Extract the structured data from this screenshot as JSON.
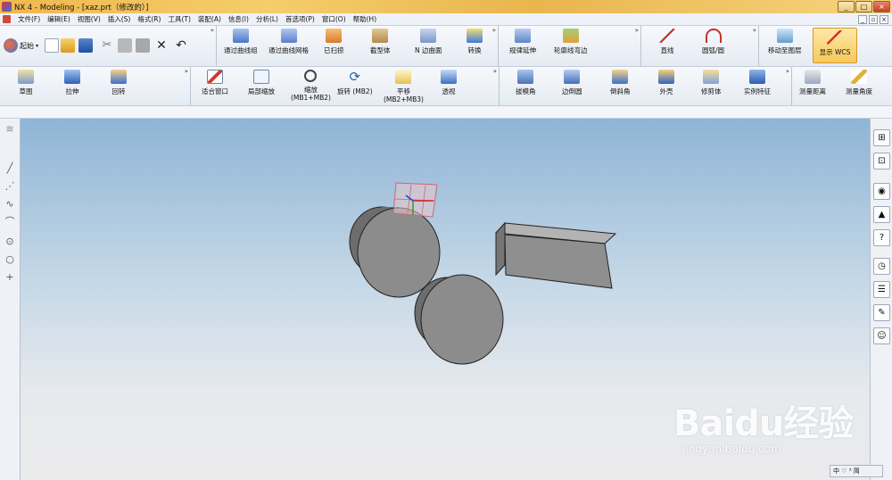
{
  "window": {
    "title": "NX 4 - Modeling - [xaz.prt（修改的）]",
    "buttons": {
      "minimize": "_",
      "maximize": "□",
      "close": "×"
    }
  },
  "menu": {
    "items": [
      "文件(F)",
      "编辑(E)",
      "视图(V)",
      "插入(S)",
      "格式(R)",
      "工具(T)",
      "装配(A)",
      "信息(I)",
      "分析(L)",
      "首选项(P)",
      "窗口(O)",
      "帮助(H)"
    ],
    "mdi_buttons": {
      "minimize": "_",
      "restore": "▫",
      "close": "×"
    }
  },
  "toolbar_top": {
    "start_label": "起始",
    "curve_tools": [
      "通过曲线组",
      "通过曲线网格",
      "已扫掠",
      "截型体",
      "N 边曲面",
      "转换"
    ],
    "rule_tools": [
      "规律延伸",
      "轮廓线弯边"
    ],
    "sketch_tools": [
      "直线",
      "圆弧/圆"
    ],
    "layer_tools": [
      "移动至图层",
      "显示 WCS"
    ]
  },
  "toolbar_bottom": {
    "feature_tools": [
      "草图",
      "拉伸",
      "回转"
    ],
    "view_tools": [
      {
        "label": "适合窗口",
        "sub": ""
      },
      {
        "label": "局部缩放",
        "sub": ""
      },
      {
        "label": "缩放",
        "sub": "(MB1+MB2)"
      },
      {
        "label": "旋转 (MB2)",
        "sub": ""
      },
      {
        "label": "平移",
        "sub": "(MB2+MB3)"
      },
      {
        "label": "透视",
        "sub": ""
      }
    ],
    "detail_tools": [
      "拔模角",
      "边倒圆",
      "倒斜角",
      "外壳",
      "修剪体",
      "实例特征"
    ],
    "measure_tools": [
      "测量距离",
      "测量角度"
    ]
  },
  "status": {
    "ime": "中 ♡ ³ 简"
  },
  "watermark": {
    "logo": "Baidu经验",
    "url": "jingyan.baidu.com"
  },
  "colors": {
    "viewport_top": "#8fb4d6",
    "viewport_bottom": "#ebebec",
    "solid_face": "#8c8c8c",
    "solid_side": "#6c6c6c",
    "active_tool": "#f7c95a"
  }
}
